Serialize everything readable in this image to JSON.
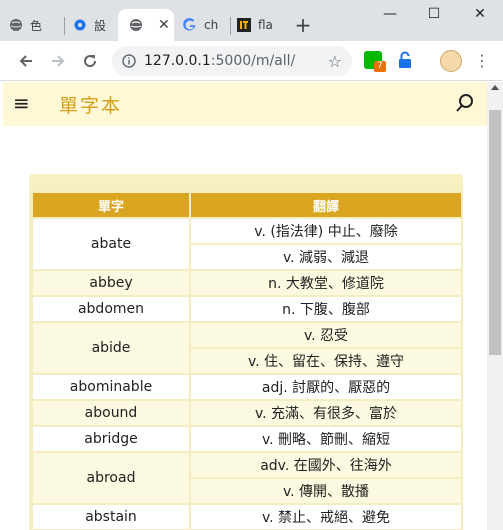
{
  "browser": {
    "tabs": [
      {
        "title": "色",
        "icon": "globe-icon"
      },
      {
        "title": "設",
        "icon": "gear-icon"
      },
      {
        "title": "",
        "icon": "globe-icon",
        "active": true,
        "close": "✕"
      },
      {
        "title": "ch",
        "icon": "google-icon"
      },
      {
        "title": "fla",
        "icon": "ithome-icon"
      }
    ],
    "new_tab": "+",
    "window_controls": {
      "minimize": "—",
      "maximize": "☐",
      "close": "✕"
    },
    "url_host": "127.0.0.1",
    "url_path": ":5000/m/all/",
    "extension_badge": "7"
  },
  "navbar": {
    "brand": "單字本"
  },
  "table": {
    "headers": [
      "單字",
      "翻譯"
    ],
    "rows": [
      {
        "word": "abate",
        "translations": [
          "v. (指法律) 中止、廢除",
          "v. 減弱、減退"
        ]
      },
      {
        "word": "abbey",
        "translations": [
          "n. 大教堂、修道院"
        ]
      },
      {
        "word": "abdomen",
        "translations": [
          "n. 下腹、腹部"
        ]
      },
      {
        "word": "abide",
        "translations": [
          "v. 忍受",
          "v. 住、留在、保持、遵守"
        ]
      },
      {
        "word": "abominable",
        "translations": [
          "adj. 討厭的、厭惡的"
        ]
      },
      {
        "word": "abound",
        "translations": [
          "v. 充滿、有很多、富於"
        ]
      },
      {
        "word": "abridge",
        "translations": [
          "v. 刪略、節刪、縮短"
        ]
      },
      {
        "word": "abroad",
        "translations": [
          "adv. 在國外、往海外",
          "v. 傳開、散播"
        ]
      },
      {
        "word": "abstain",
        "translations": [
          "v. 禁止、戒絕、避免"
        ]
      }
    ]
  },
  "colors": {
    "header_bg": "#daa520",
    "navbar_bg": "#fff8d6",
    "brand": "#d4a017"
  }
}
